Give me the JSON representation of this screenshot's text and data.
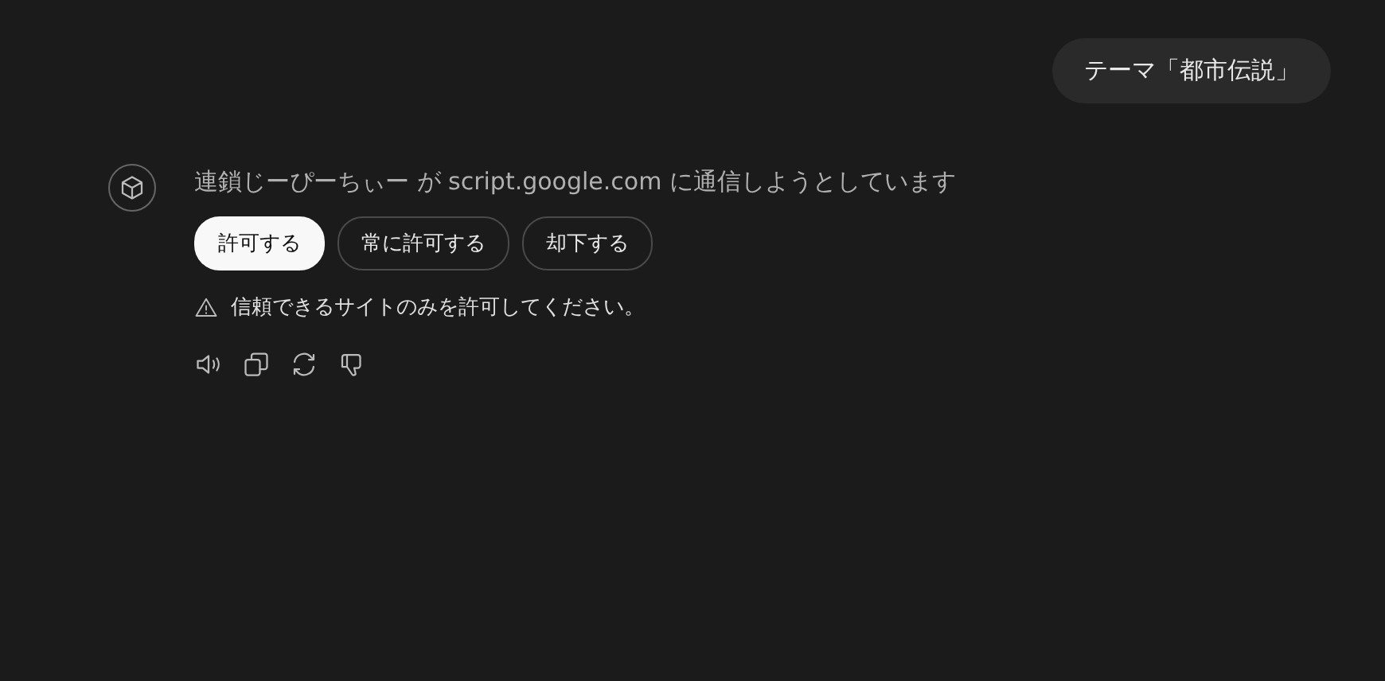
{
  "user_message": {
    "text": "テーマ「都市伝説」"
  },
  "assistant": {
    "message": "連鎖じーぴーちぃー が script.google.com に通信しようとしています",
    "buttons": [
      {
        "label": "許可する",
        "kind": "primary"
      },
      {
        "label": "常に許可する",
        "kind": "outline"
      },
      {
        "label": "却下する",
        "kind": "outline"
      }
    ],
    "warning": "信頼できるサイトのみを許可してください。"
  }
}
